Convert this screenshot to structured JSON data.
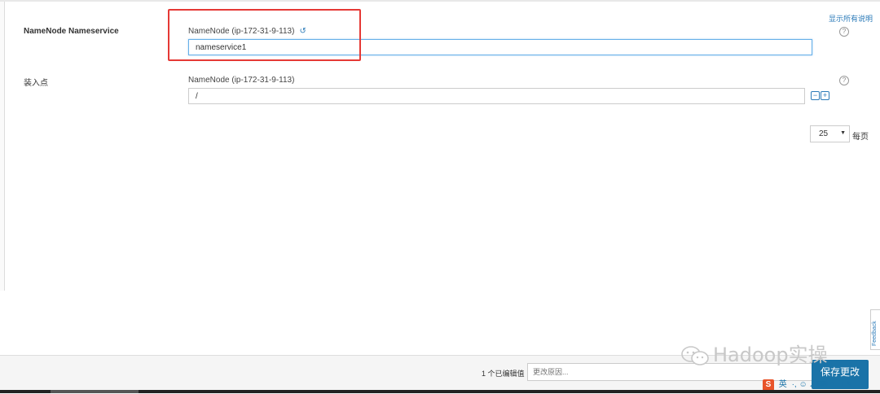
{
  "settings": {
    "show_all_help": "显示所有说明",
    "rows": [
      {
        "label": "NameNode Nameservice",
        "field_label": "NameNode (ip-172-31-9-113)",
        "value": "nameservice1",
        "has_undo": true
      },
      {
        "label": "装入点",
        "field_label": "NameNode (ip-172-31-9-113)",
        "value": "/",
        "has_undo": false
      }
    ],
    "help_glyph": "?",
    "remove_glyph": "−",
    "add_glyph": "+",
    "undo_glyph": "↺"
  },
  "pagination": {
    "page_size": "25",
    "per_page_label": "每页"
  },
  "footer": {
    "edited_count": "1 个已编辑值",
    "reason_placeholder": "更改原因...",
    "save_label": "保存更改"
  },
  "feedback": {
    "label": "Feedback"
  },
  "watermark": {
    "text": "Hadoop实操"
  },
  "ime": {
    "logo": "S",
    "lang": "英",
    "icons": "·, ☺ ♪ ⌨ ♦ ☗ ✎"
  },
  "colors": {
    "accent": "#2a7ab8",
    "highlight": "#e53935",
    "save": "#1a73a8"
  }
}
